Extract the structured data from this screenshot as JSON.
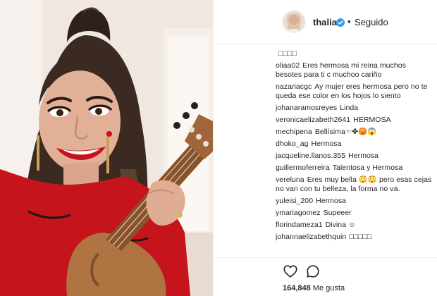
{
  "header": {
    "username": "thalia",
    "separator": "•",
    "follow_status": "Seguido"
  },
  "comments": [
    {
      "user": "",
      "text": "□□□□"
    },
    {
      "user": "oliaa02",
      "text": "Eres hermosa mi reina muchos besotes para ti c muchoo cariño"
    },
    {
      "user": "nazariacgc",
      "text": "Ay mujer eres hermosa pero no te queda ese color en los hojos lo siento"
    },
    {
      "user": "johanaramosreyes",
      "text": "Linda"
    },
    {
      "user": "veronicaelizabeth2641",
      "text": "HERMOSA"
    },
    {
      "user": "mechipena",
      "text": "Bellísima☜✤😡😱"
    },
    {
      "user": "dhoko_ag",
      "text": "Hermosa"
    },
    {
      "user": "jacqueline.llanos.355",
      "text": "Hermosa"
    },
    {
      "user": "guillermoferreira",
      "text": "Talentosa y Hermosa"
    },
    {
      "user": "vereluna",
      "text": "Eres muy bella 😳😳 pero esas cejas no van con tu belleza, la forma no va."
    },
    {
      "user": "yuleisi_200",
      "text": "Hermosa"
    },
    {
      "user": "ymariagomez",
      "text": "Supeeer"
    },
    {
      "user": "florindameza1",
      "text": "Divina ☺"
    },
    {
      "user": "johannaelizabethquin",
      "text": "□□□□□"
    }
  ],
  "actions": {
    "like_icon": "heart-icon",
    "comment_icon": "comment-bubble-icon",
    "likes_count": "164,848",
    "likes_label": "Me gusta"
  },
  "colors": {
    "text": "#262626",
    "verified_blue": "#3897f0",
    "divider": "#efefef"
  }
}
